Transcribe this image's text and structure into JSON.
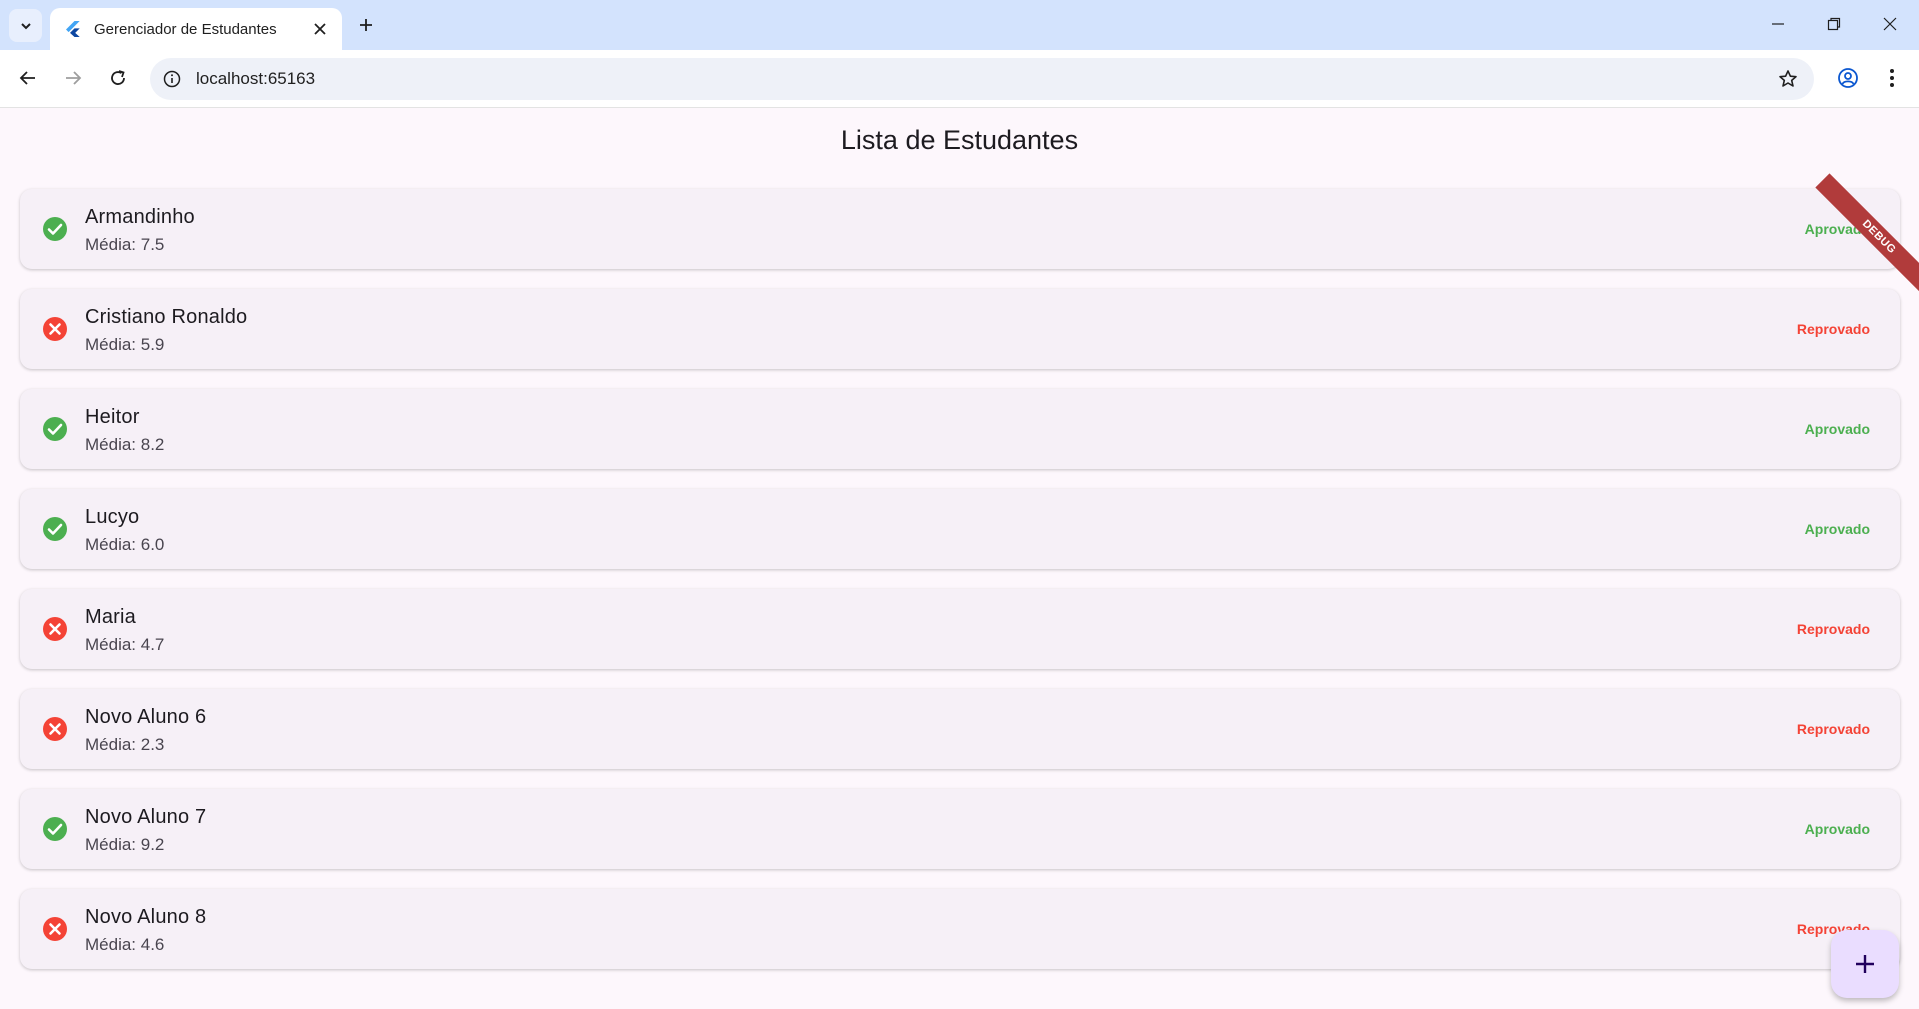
{
  "browser": {
    "tab_title": "Gerenciador de Estudantes",
    "url": "localhost:65163"
  },
  "app": {
    "title": "Lista de Estudantes",
    "debug_label": "DEBUG",
    "colors": {
      "approved": "#4caf50",
      "failed": "#f44336",
      "fab": "#eaddff"
    },
    "students": [
      {
        "name": "Armandinho",
        "average": "Média: 7.5",
        "status": "Aprovado",
        "approved": true,
        "icon": "check-circle-icon"
      },
      {
        "name": "Cristiano Ronaldo",
        "average": "Média: 5.9",
        "status": "Reprovado",
        "approved": false,
        "icon": "cancel-circle-icon"
      },
      {
        "name": "Heitor",
        "average": "Média: 8.2",
        "status": "Aprovado",
        "approved": true,
        "icon": "check-circle-icon"
      },
      {
        "name": "Lucyo",
        "average": "Média: 6.0",
        "status": "Aprovado",
        "approved": true,
        "icon": "check-circle-icon"
      },
      {
        "name": "Maria",
        "average": "Média: 4.7",
        "status": "Reprovado",
        "approved": false,
        "icon": "cancel-circle-icon"
      },
      {
        "name": "Novo Aluno 6",
        "average": "Média: 2.3",
        "status": "Reprovado",
        "approved": false,
        "icon": "cancel-circle-icon"
      },
      {
        "name": "Novo Aluno 7",
        "average": "Média: 9.2",
        "status": "Aprovado",
        "approved": true,
        "icon": "check-circle-icon"
      },
      {
        "name": "Novo Aluno 8",
        "average": "Média: 4.6",
        "status": "Reprovado",
        "approved": false,
        "icon": "cancel-circle-icon"
      }
    ],
    "fab_icon": "plus-icon"
  }
}
